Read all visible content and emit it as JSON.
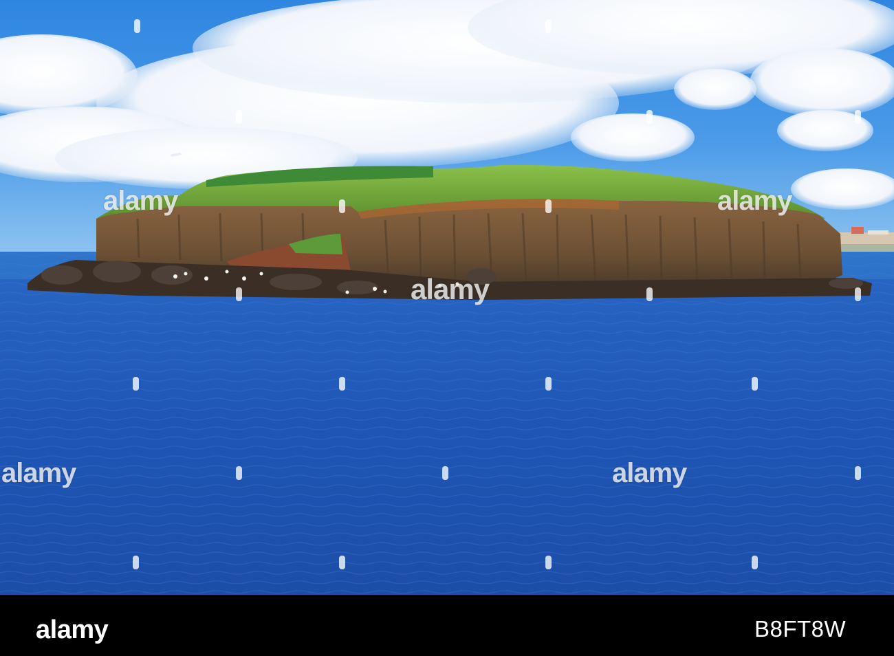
{
  "photo": {
    "watermark_text": "alamy",
    "sky_color": "#3f93e4",
    "sea_color": "#1e57b8",
    "cliff_color": "#7a5a3c",
    "grass_color": "#6fa83a"
  },
  "footer": {
    "brand": "alamy",
    "image_id": "B8FT8W",
    "background_color": "#000000"
  }
}
